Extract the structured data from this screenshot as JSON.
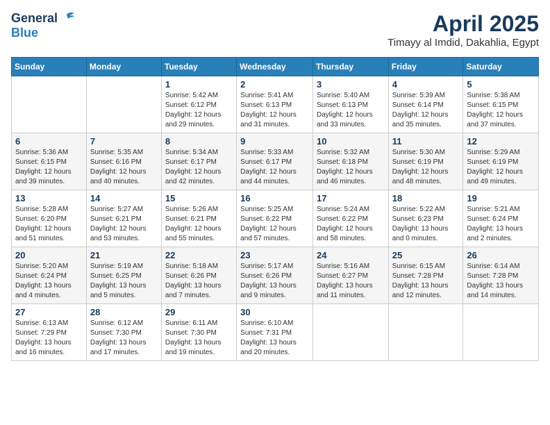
{
  "logo": {
    "general": "General",
    "blue": "Blue"
  },
  "header": {
    "month": "April 2025",
    "location": "Timayy al Imdid, Dakahlia, Egypt"
  },
  "weekdays": [
    "Sunday",
    "Monday",
    "Tuesday",
    "Wednesday",
    "Thursday",
    "Friday",
    "Saturday"
  ],
  "weeks": [
    [
      {
        "day": "",
        "info": ""
      },
      {
        "day": "",
        "info": ""
      },
      {
        "day": "1",
        "info": "Sunrise: 5:42 AM\nSunset: 6:12 PM\nDaylight: 12 hours\nand 29 minutes."
      },
      {
        "day": "2",
        "info": "Sunrise: 5:41 AM\nSunset: 6:13 PM\nDaylight: 12 hours\nand 31 minutes."
      },
      {
        "day": "3",
        "info": "Sunrise: 5:40 AM\nSunset: 6:13 PM\nDaylight: 12 hours\nand 33 minutes."
      },
      {
        "day": "4",
        "info": "Sunrise: 5:39 AM\nSunset: 6:14 PM\nDaylight: 12 hours\nand 35 minutes."
      },
      {
        "day": "5",
        "info": "Sunrise: 5:38 AM\nSunset: 6:15 PM\nDaylight: 12 hours\nand 37 minutes."
      }
    ],
    [
      {
        "day": "6",
        "info": "Sunrise: 5:36 AM\nSunset: 6:15 PM\nDaylight: 12 hours\nand 39 minutes."
      },
      {
        "day": "7",
        "info": "Sunrise: 5:35 AM\nSunset: 6:16 PM\nDaylight: 12 hours\nand 40 minutes."
      },
      {
        "day": "8",
        "info": "Sunrise: 5:34 AM\nSunset: 6:17 PM\nDaylight: 12 hours\nand 42 minutes."
      },
      {
        "day": "9",
        "info": "Sunrise: 5:33 AM\nSunset: 6:17 PM\nDaylight: 12 hours\nand 44 minutes."
      },
      {
        "day": "10",
        "info": "Sunrise: 5:32 AM\nSunset: 6:18 PM\nDaylight: 12 hours\nand 46 minutes."
      },
      {
        "day": "11",
        "info": "Sunrise: 5:30 AM\nSunset: 6:19 PM\nDaylight: 12 hours\nand 48 minutes."
      },
      {
        "day": "12",
        "info": "Sunrise: 5:29 AM\nSunset: 6:19 PM\nDaylight: 12 hours\nand 49 minutes."
      }
    ],
    [
      {
        "day": "13",
        "info": "Sunrise: 5:28 AM\nSunset: 6:20 PM\nDaylight: 12 hours\nand 51 minutes."
      },
      {
        "day": "14",
        "info": "Sunrise: 5:27 AM\nSunset: 6:21 PM\nDaylight: 12 hours\nand 53 minutes."
      },
      {
        "day": "15",
        "info": "Sunrise: 5:26 AM\nSunset: 6:21 PM\nDaylight: 12 hours\nand 55 minutes."
      },
      {
        "day": "16",
        "info": "Sunrise: 5:25 AM\nSunset: 6:22 PM\nDaylight: 12 hours\nand 57 minutes."
      },
      {
        "day": "17",
        "info": "Sunrise: 5:24 AM\nSunset: 6:22 PM\nDaylight: 12 hours\nand 58 minutes."
      },
      {
        "day": "18",
        "info": "Sunrise: 5:22 AM\nSunset: 6:23 PM\nDaylight: 13 hours\nand 0 minutes."
      },
      {
        "day": "19",
        "info": "Sunrise: 5:21 AM\nSunset: 6:24 PM\nDaylight: 13 hours\nand 2 minutes."
      }
    ],
    [
      {
        "day": "20",
        "info": "Sunrise: 5:20 AM\nSunset: 6:24 PM\nDaylight: 13 hours\nand 4 minutes."
      },
      {
        "day": "21",
        "info": "Sunrise: 5:19 AM\nSunset: 6:25 PM\nDaylight: 13 hours\nand 5 minutes."
      },
      {
        "day": "22",
        "info": "Sunrise: 5:18 AM\nSunset: 6:26 PM\nDaylight: 13 hours\nand 7 minutes."
      },
      {
        "day": "23",
        "info": "Sunrise: 5:17 AM\nSunset: 6:26 PM\nDaylight: 13 hours\nand 9 minutes."
      },
      {
        "day": "24",
        "info": "Sunrise: 5:16 AM\nSunset: 6:27 PM\nDaylight: 13 hours\nand 11 minutes."
      },
      {
        "day": "25",
        "info": "Sunrise: 6:15 AM\nSunset: 7:28 PM\nDaylight: 13 hours\nand 12 minutes."
      },
      {
        "day": "26",
        "info": "Sunrise: 6:14 AM\nSunset: 7:28 PM\nDaylight: 13 hours\nand 14 minutes."
      }
    ],
    [
      {
        "day": "27",
        "info": "Sunrise: 6:13 AM\nSunset: 7:29 PM\nDaylight: 13 hours\nand 16 minutes."
      },
      {
        "day": "28",
        "info": "Sunrise: 6:12 AM\nSunset: 7:30 PM\nDaylight: 13 hours\nand 17 minutes."
      },
      {
        "day": "29",
        "info": "Sunrise: 6:11 AM\nSunset: 7:30 PM\nDaylight: 13 hours\nand 19 minutes."
      },
      {
        "day": "30",
        "info": "Sunrise: 6:10 AM\nSunset: 7:31 PM\nDaylight: 13 hours\nand 20 minutes."
      },
      {
        "day": "",
        "info": ""
      },
      {
        "day": "",
        "info": ""
      },
      {
        "day": "",
        "info": ""
      }
    ]
  ]
}
